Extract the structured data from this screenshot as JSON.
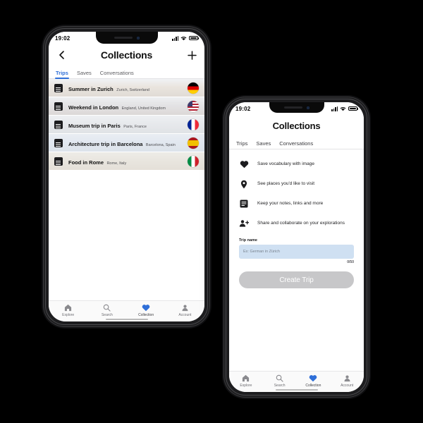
{
  "colors": {
    "accent": "#2f6fd8",
    "background": "#000000",
    "screen": "#ffffff",
    "input_fill": "#cfe0f2",
    "disabled_button": "#c7c7c9",
    "icon_dark": "#1c1c1e"
  },
  "phone_1": {
    "status": {
      "time": "19:02",
      "signal_icon": "cellular-signal-icon",
      "wifi_icon": "wifi-icon",
      "battery_icon": "battery-full-icon"
    },
    "header": {
      "back_icon": "chevron-left-icon",
      "title": "Collections",
      "add_icon": "plus-icon"
    },
    "tabs": [
      {
        "label": "Trips",
        "active": true
      },
      {
        "label": "Saves",
        "active": false
      },
      {
        "label": "Conversations",
        "active": false
      }
    ],
    "trips": [
      {
        "title": "Summer in Zurich",
        "subtitle": "Zurich, Switzerland",
        "flag": "flag-germany",
        "icon": "notes-icon"
      },
      {
        "title": "Weekend in London",
        "subtitle": "England, United Kingdom",
        "flag": "flag-usa",
        "icon": "notes-icon"
      },
      {
        "title": "Museum trip in Paris",
        "subtitle": "Paris, France",
        "flag": "flag-france",
        "icon": "notes-icon"
      },
      {
        "title": "Architecture trip in Barcelona",
        "subtitle": "Barcelona, Spain",
        "flag": "flag-spain",
        "icon": "notes-icon"
      },
      {
        "title": "Food in Rome",
        "subtitle": "Rome, Italy",
        "flag": "flag-italy",
        "icon": "notes-icon"
      }
    ],
    "tabbar": [
      {
        "label": "Explore",
        "icon": "home-icon",
        "active": false
      },
      {
        "label": "Search",
        "icon": "search-icon",
        "active": false
      },
      {
        "label": "Collection",
        "icon": "heart-icon",
        "active": true
      },
      {
        "label": "Account",
        "icon": "person-icon",
        "active": false
      }
    ]
  },
  "phone_2": {
    "status": {
      "time": "19:02",
      "signal_icon": "cellular-signal-icon",
      "wifi_icon": "wifi-icon",
      "battery_icon": "battery-full-icon"
    },
    "header": {
      "title": "Collections"
    },
    "tabs": [
      {
        "label": "Trips",
        "active": true
      },
      {
        "label": "Saves",
        "active": false
      },
      {
        "label": "Conversations",
        "active": false
      }
    ],
    "features": [
      {
        "icon": "heart-icon",
        "text": "Save vocabulary with image"
      },
      {
        "icon": "location-pin-icon",
        "text": "See places you'd like to visit"
      },
      {
        "icon": "notes-icon",
        "text": "Keep your notes, links and more"
      },
      {
        "icon": "person-add-icon",
        "text": "Share and collaborate on your explorations"
      }
    ],
    "form": {
      "label": "Trip name",
      "value": "",
      "placeholder": "Ex: German in Zürich",
      "counter": "0/50",
      "submit_label": "Create Trip",
      "submit_disabled": true
    },
    "tabbar": [
      {
        "label": "Explore",
        "icon": "home-icon",
        "active": false
      },
      {
        "label": "Search",
        "icon": "search-icon",
        "active": false
      },
      {
        "label": "Collection",
        "icon": "heart-icon",
        "active": true
      },
      {
        "label": "Account",
        "icon": "person-icon",
        "active": false
      }
    ]
  }
}
